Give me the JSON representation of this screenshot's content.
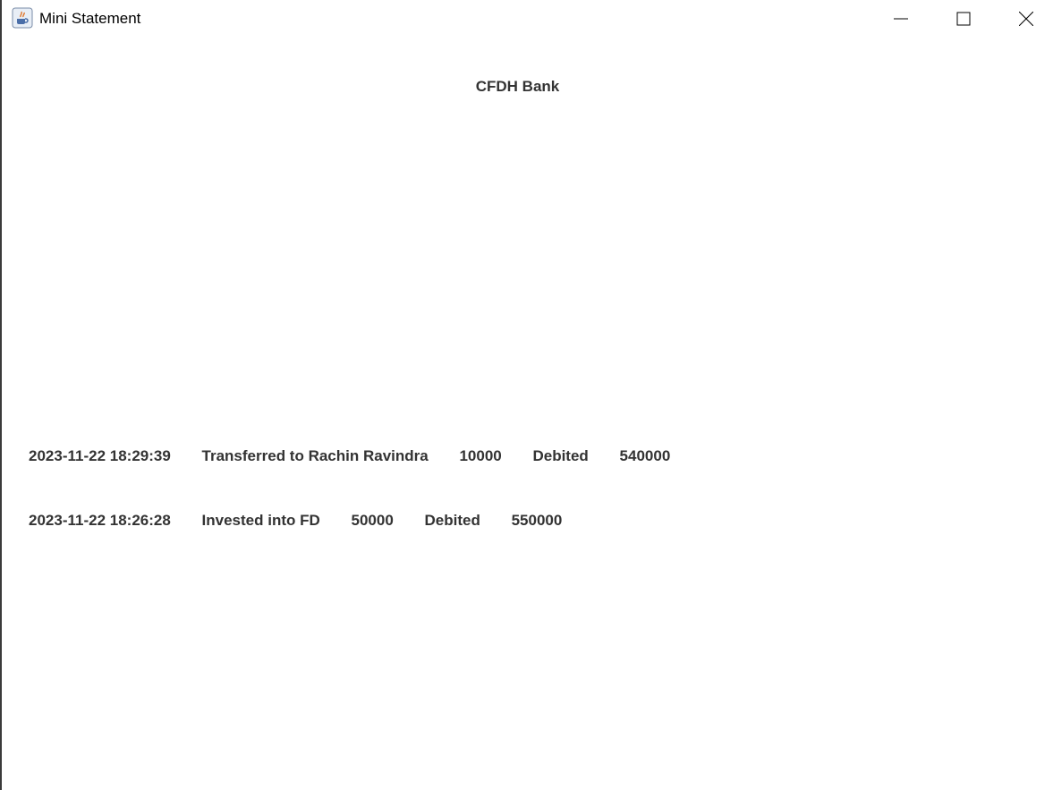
{
  "window": {
    "title": "Mini Statement",
    "icon": "java-icon"
  },
  "bank": {
    "name": "CFDH Bank"
  },
  "transactions": [
    {
      "datetime": "2023-11-22 18:29:39",
      "description": "Transferred to Rachin Ravindra",
      "amount": "10000",
      "type": "Debited",
      "balance": "540000"
    },
    {
      "datetime": "2023-11-22 18:26:28",
      "description": "Invested into FD",
      "amount": "50000",
      "type": "Debited",
      "balance": "550000"
    }
  ]
}
